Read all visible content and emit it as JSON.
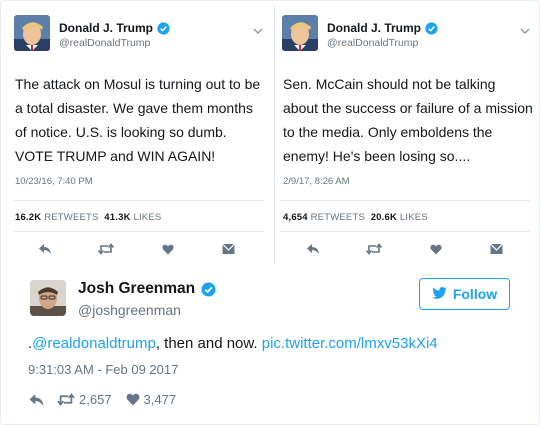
{
  "tweet1": {
    "name": "Donald J. Trump",
    "handle": "@realDonaldTrump",
    "text": "The attack on Mosul is turning out to be a total disaster. We gave them months of notice. U.S. is looking so dumb. VOTE TRUMP and WIN AGAIN!",
    "timestamp": "10/23/16, 7:40 PM",
    "retweets": "16.2K",
    "retweets_label": "RETWEETS",
    "likes": "41.3K",
    "likes_label": "LIKES"
  },
  "tweet2": {
    "name": "Donald J. Trump",
    "handle": "@realDonaldTrump",
    "text": "Sen. McCain should not be talking about the success or failure of a mission to the media. Only emboldens the enemy! He's been losing so....",
    "timestamp": "2/9/17, 8:26 AM",
    "retweets": "4,654",
    "retweets_label": "RETWEETS",
    "likes": "20.6K",
    "likes_label": "LIKES"
  },
  "main": {
    "name": "Josh Greenman",
    "handle": "@joshgreenman",
    "follow_label": "Follow",
    "text_prefix": ".",
    "mention": "@realdonaldtrump",
    "text_middle": ", then and now. ",
    "media_link": "pic.twitter.com/lmxv53kXi4",
    "timestamp": "9:31:03 AM - Feb 09 2017",
    "retweets": "2,657",
    "likes": "3,477"
  },
  "colors": {
    "accent": "#1da1f2",
    "text": "#14171a",
    "muted": "#66757f",
    "border": "#e1e8ed"
  },
  "icons": [
    "verified-badge-icon",
    "caret-down-icon",
    "reply-icon",
    "retweet-icon",
    "like-heart-icon",
    "direct-message-icon",
    "twitter-bird-icon"
  ]
}
